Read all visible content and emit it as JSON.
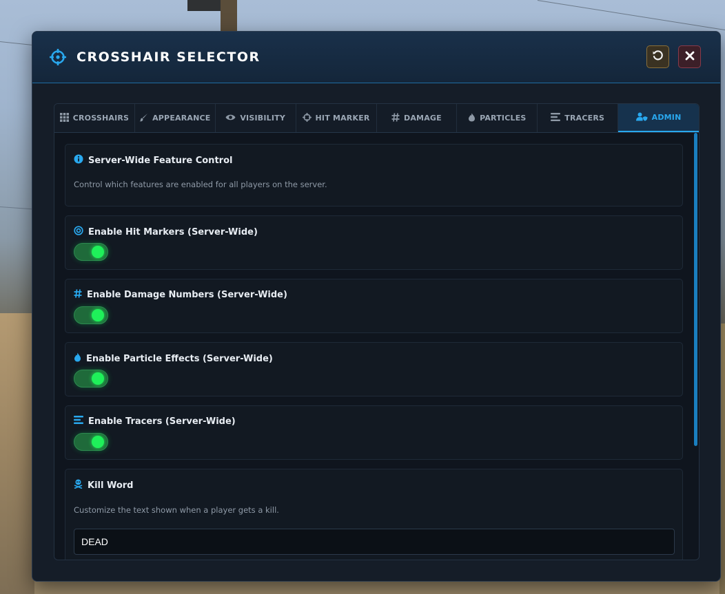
{
  "window": {
    "title": "CROSSHAIR SELECTOR"
  },
  "tabs": [
    {
      "label": "CROSSHAIRS",
      "icon": "grid-icon",
      "active": false
    },
    {
      "label": "APPEARANCE",
      "icon": "brush-icon",
      "active": false
    },
    {
      "label": "VISIBILITY",
      "icon": "eye-icon",
      "active": false
    },
    {
      "label": "HIT MARKER",
      "icon": "crosshair-icon",
      "active": false
    },
    {
      "label": "DAMAGE",
      "icon": "hash-icon",
      "active": false
    },
    {
      "label": "PARTICLES",
      "icon": "flame-icon",
      "active": false
    },
    {
      "label": "TRACERS",
      "icon": "lines-icon",
      "active": false
    },
    {
      "label": "ADMIN",
      "icon": "user-shield-icon",
      "active": true
    }
  ],
  "admin": {
    "info": {
      "title": "Server-Wide Feature Control",
      "description": "Control which features are enabled for all players on the server."
    },
    "hit_markers": {
      "label": "Enable Hit Markers (Server-Wide)",
      "enabled": true
    },
    "damage_numbers": {
      "label": "Enable Damage Numbers (Server-Wide)",
      "enabled": true
    },
    "particle_effects": {
      "label": "Enable Particle Effects (Server-Wide)",
      "enabled": true
    },
    "tracers": {
      "label": "Enable Tracers (Server-Wide)",
      "enabled": true
    },
    "kill_word": {
      "title": "Kill Word",
      "description": "Customize the text shown when a player gets a kill.",
      "value": "DEAD"
    }
  },
  "colors": {
    "accent": "#29a8ee",
    "toggle_on": "#1ff05a",
    "panel_bg": "#151d28"
  }
}
